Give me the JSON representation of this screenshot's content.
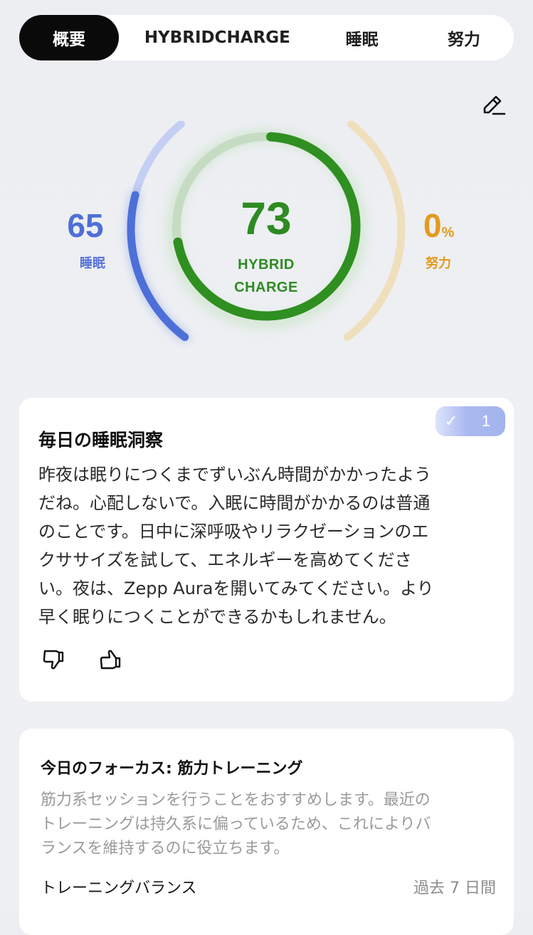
{
  "tabs": [
    {
      "label": "概要",
      "active": true
    },
    {
      "label": "HYBRIDCHARGE",
      "active": false
    },
    {
      "label": "睡眠",
      "active": false
    },
    {
      "label": "努力",
      "active": false
    }
  ],
  "gauge": {
    "sleep": {
      "value": "65",
      "label": "睡眠",
      "color": "#4f6fd6",
      "level": 0.65
    },
    "hybrid_charge": {
      "value": "73",
      "label_line1": "HYBRID",
      "label_line2": "CHARGE",
      "color": "#2e8b22",
      "level": 0.73
    },
    "effort": {
      "value": "0",
      "unit": "%",
      "label": "努力",
      "color": "#e39a1d",
      "level": 0.0
    }
  },
  "sleep_insight_card": {
    "title": "毎日の睡眠洞察",
    "badge_count": "1",
    "body_lines": [
      "昨夜は眠りにつくまでずいぶん時間がかかったよう",
      "だね。心配しないで。入眠に時間がかかるのは普通",
      "のことです。日中に深呼吸やリラクゼーションのエ",
      "クササイズを試して、エネルギーを高めてくださ",
      "い。夜は、Zepp Auraを開いてみてください。より",
      "早く眠りにつくことができるかもしれません。"
    ]
  },
  "focus_card": {
    "title": "今日のフォーカス: 筋力トレーニング",
    "body_lines": [
      "筋力系セッションを行うことをおすすめします。最近の",
      "トレーニングは持久系に偏っているため、これによりバ",
      "ランスを維持するのに役立ちます。"
    ],
    "row_left": "トレーニングバランス",
    "row_right": "過去 7 日間"
  },
  "icons": {
    "edit": "pencil-edit-icon",
    "check": "checkmark-icon",
    "dislike": "thumbs-down-icon",
    "like": "thumbs-up-icon"
  }
}
